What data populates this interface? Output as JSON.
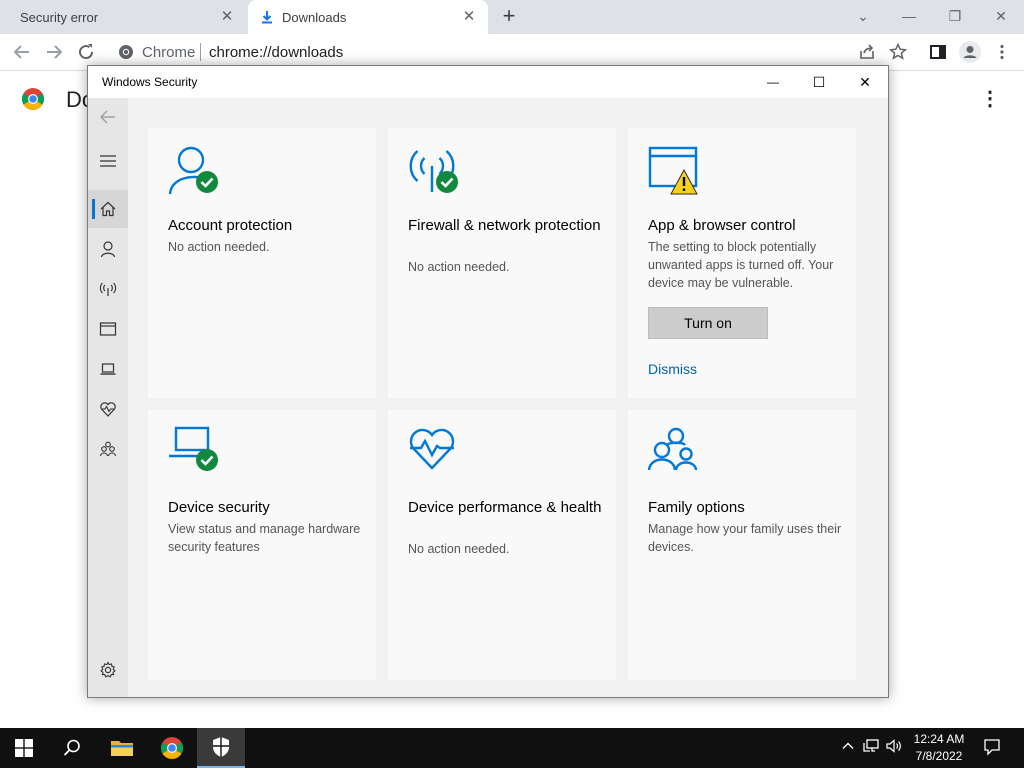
{
  "browser": {
    "tabs": [
      {
        "label": "Security error"
      },
      {
        "label": "Downloads"
      }
    ],
    "tab_close_glyph": "✕",
    "new_tab_glyph": "+",
    "window_controls": {
      "collapse": "⌄",
      "minimize": "—",
      "restore": "❐",
      "close": "✕"
    },
    "omnibox": {
      "site": "Chrome",
      "url": "chrome://downloads"
    },
    "page": {
      "title": "Downloads",
      "title_visible": "Do",
      "menu_glyph": "⋮"
    }
  },
  "window": {
    "title": "Windows Security",
    "controls": {
      "minimize": "—",
      "maximize": "☐",
      "close": "✕"
    },
    "sidebar": {
      "items": [
        {
          "name": "back-arrow-icon"
        },
        {
          "name": "hamburger-menu-icon"
        },
        {
          "name": "home-icon"
        },
        {
          "name": "account-protection-icon"
        },
        {
          "name": "firewall-network-icon"
        },
        {
          "name": "app-browser-control-icon"
        },
        {
          "name": "device-security-icon"
        },
        {
          "name": "device-performance-icon"
        },
        {
          "name": "family-options-icon"
        },
        {
          "name": "settings-gear-icon"
        }
      ]
    },
    "tiles": [
      {
        "title": "Account protection",
        "description": "No action needed.",
        "icon": "account-protection-icon",
        "status": "ok"
      },
      {
        "title": "Firewall & network protection",
        "description": "No action needed.",
        "icon": "firewall-network-icon",
        "status": "ok"
      },
      {
        "title": "App & browser control",
        "description": "The setting to block potentially unwanted apps is turned off. Your device may be vulnerable.",
        "icon": "app-browser-control-icon",
        "status": "warning",
        "button": "Turn on",
        "link": "Dismiss"
      },
      {
        "title": "Device security",
        "description": "View status and manage hardware security features",
        "icon": "device-security-icon",
        "status": "ok"
      },
      {
        "title": "Device performance & health",
        "description": "No action needed.",
        "icon": "device-performance-icon",
        "status": "none"
      },
      {
        "title": "Family options",
        "description": "Manage how your family uses their devices.",
        "icon": "family-options-icon",
        "status": "none"
      }
    ]
  },
  "taskbar": {
    "clock": {
      "time": "12:24 AM",
      "date": "7/8/2022"
    }
  },
  "colors": {
    "accent_blue": "#0078d7",
    "check_green": "#10893e",
    "warning_yellow": "#f8d11c",
    "link_blue": "#0063b1"
  }
}
